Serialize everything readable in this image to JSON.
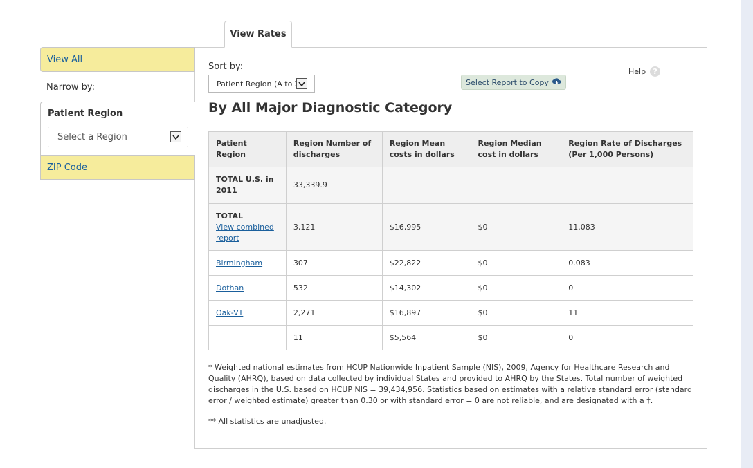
{
  "tabs": {
    "view_rates": "View Rates"
  },
  "sidebar": {
    "view_all": "View All",
    "narrow_by": "Narrow by:",
    "patient_region": "Patient Region",
    "region_select_value": "Select a Region",
    "zip_code": "ZIP Code"
  },
  "controls": {
    "sort_label": "Sort by:",
    "sort_value": "Patient Region (A to Z",
    "copy_button": "Select Report to Copy",
    "help": "Help",
    "help_icon_glyph": "?"
  },
  "report": {
    "title": "By All Major Diagnostic Category",
    "columns": [
      "Patient Region",
      "Region Number of discharges",
      "Region Mean costs in dollars",
      "Region Median cost in dollars",
      "Region Rate of Discharges (Per 1,000 Persons)"
    ],
    "rows": [
      {
        "region": "TOTAL U.S. in 2011",
        "discharges": "33,339.9",
        "mean": "",
        "median": "",
        "rate": ""
      },
      {
        "region": "TOTAL",
        "link": "View combined report",
        "discharges": "3,121",
        "mean": "$16,995",
        "median": "$0",
        "rate": "11.083"
      },
      {
        "region": "Birmingham",
        "discharges": "307",
        "mean": "$22,822",
        "median": "$0",
        "rate": "0.083"
      },
      {
        "region": "Dothan",
        "discharges": "532",
        "mean": "$14,302",
        "median": "$0",
        "rate": "0"
      },
      {
        "region": "Oak-VT",
        "discharges": "2,271",
        "mean": "$16,897",
        "median": "$0",
        "rate": "11"
      },
      {
        "region": "",
        "discharges": "11",
        "mean": "$5,564",
        "median": "$0",
        "rate": "0"
      }
    ],
    "footnote_1": "* Weighted national estimates from HCUP Nationwide Inpatient Sample (NIS), 2009, Agency for Healthcare Research and Quality (AHRQ), based on data collected by individual States and provided to AHRQ by the States. Total number of weighted discharges in the U.S. based on HCUP NIS = 39,434,956. Statistics based on estimates with a relative standard error (standard error / weighted estimate) greater than 0.30 or with standard error = 0 are not reliable, and are designated with a †.",
    "footnote_2": "** All statistics are unadjusted."
  }
}
